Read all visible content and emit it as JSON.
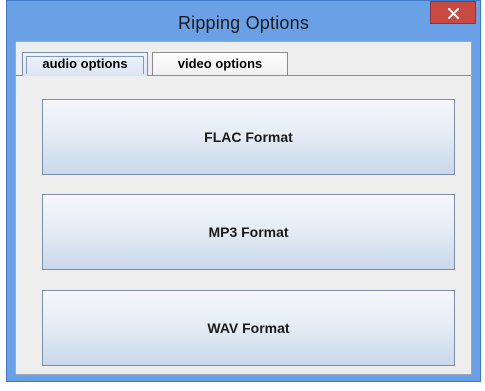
{
  "window": {
    "title": "Ripping Options",
    "close_icon": "close-icon"
  },
  "tabs": [
    {
      "label": "audio options",
      "selected": true
    },
    {
      "label": "video options",
      "selected": false
    }
  ],
  "audio_panel": {
    "buttons": [
      {
        "label": "FLAC Format"
      },
      {
        "label": "MP3 Format"
      },
      {
        "label": "WAV Format"
      }
    ]
  },
  "colors": {
    "titlebar": "#6aa0e6",
    "close_button": "#c94a43",
    "panel_background": "#eeeeee"
  }
}
